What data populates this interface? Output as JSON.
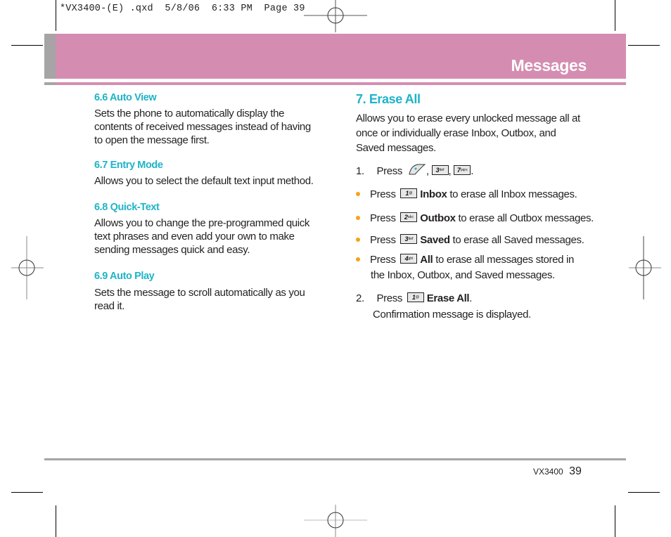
{
  "slug": "*VX3400-(E) .qxd  5/8/06  6:33 PM  Page 39",
  "header": {
    "title": "Messages",
    "band_color": "#d48db1",
    "tab_color": "#a6a4a5"
  },
  "left_column": {
    "sections": [
      {
        "heading": "6.6 Auto View",
        "body_lines": [
          "Sets the phone to automatically display the",
          "contents of received messages instead of having",
          "to open the message first."
        ]
      },
      {
        "heading": "6.7 Entry Mode",
        "body_lines": [
          "Allows you to select the default text input method."
        ]
      },
      {
        "heading": "6.8 Quick-Text",
        "body_lines": [
          "Allows you to change the pre-programmed quick",
          "text phrases and even add your own to make",
          "sending messages quick and easy."
        ]
      },
      {
        "heading": "6.9 Auto Play",
        "body_lines": [
          "Sets the message to scroll automatically as you",
          "read it."
        ]
      }
    ]
  },
  "right_column": {
    "heading": "7. Erase All",
    "intro_lines": [
      "Allows you to erase every unlocked message all at",
      "once or individually erase Inbox, Outbox, and",
      "Saved messages."
    ],
    "step1": {
      "number": "1.",
      "press": "Press",
      "keys": [
        {
          "icon": "left-soft-key-icon"
        },
        {
          "digit": "3",
          "letters": "def",
          "icon": "key-3-icon"
        },
        {
          "digit": "7",
          "letters": "pqrs",
          "icon": "key-7-icon"
        }
      ]
    },
    "bullets": [
      {
        "press": "Press",
        "key_digit": "1",
        "key_letters": "@",
        "option": "Inbox",
        "text": " to erase all Inbox messages."
      },
      {
        "press": "Press",
        "key_digit": "2",
        "key_letters": "abc",
        "option": "Outbox",
        "text": " to erase all Outbox messages."
      },
      {
        "press": "Press",
        "key_digit": "3",
        "key_letters": "def",
        "option": "Saved",
        "text": " to erase all Saved messages."
      },
      {
        "press": "Press",
        "key_digit": "4",
        "key_letters": "ghi",
        "option": "All",
        "text": " to erase all messages stored in",
        "continuation": "the Inbox, Outbox, and Saved messages."
      }
    ],
    "step2": {
      "number": "2.",
      "press": "Press",
      "key_digit": "1",
      "key_letters": "@",
      "option": "Erase All",
      "period": ".",
      "note": "Confirmation message is displayed."
    }
  },
  "footer": {
    "model": "VX3400",
    "page_number": "39"
  },
  "colors": {
    "heading_cyan": "#1fb3c8",
    "bullet_orange": "#f5a21b",
    "rule_grey": "#a6a4a5"
  }
}
